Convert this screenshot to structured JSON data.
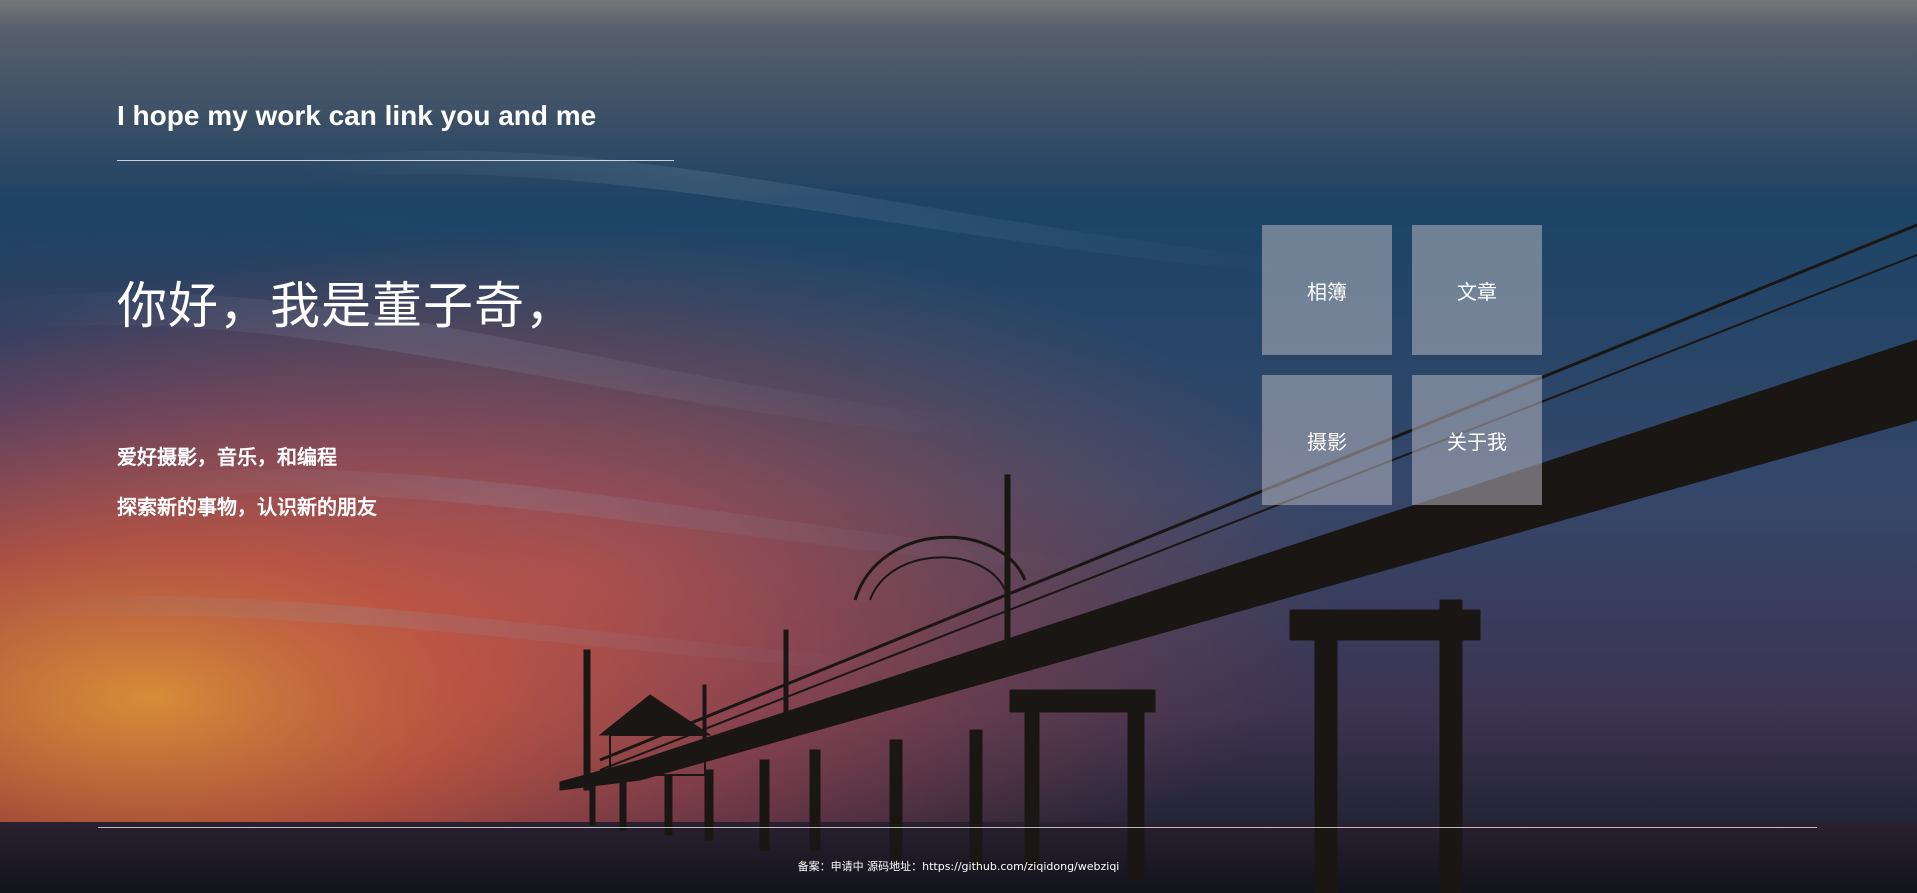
{
  "header": {
    "headline": "I hope my work can link you and me"
  },
  "intro": {
    "greeting": "你好，我是董子奇，",
    "bio_line_1": "爱好摄影，音乐，和编程",
    "bio_line_2": "探索新的事物，认识新的朋友"
  },
  "nav_tiles": [
    {
      "label": "相簿"
    },
    {
      "label": "文章"
    },
    {
      "label": "摄影"
    },
    {
      "label": "关于我"
    }
  ],
  "footer": {
    "record": "备案：申请中",
    "source_label": "源码地址：",
    "source_url": "https://github.com/ziqidong/webziqi"
  },
  "colors": {
    "tile_bg": "#a7abb6",
    "text": "#ffffff"
  },
  "background": {
    "image": "pier-at-sunset-photo"
  }
}
